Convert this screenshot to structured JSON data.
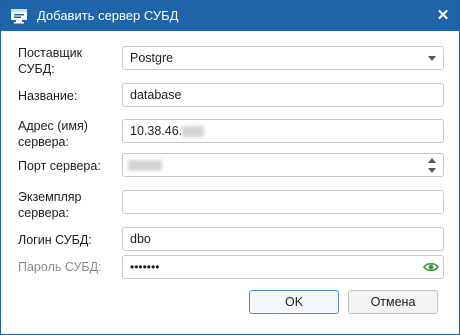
{
  "dialog": {
    "title": "Добавить сервер СУБД",
    "close_glyph": "✕",
    "title_icon": "server-window-icon"
  },
  "fields": {
    "provider": {
      "label": "Поставщик СУБД:",
      "value": "Postgre"
    },
    "name": {
      "label": "Название:",
      "value": "database"
    },
    "address": {
      "label": "Адрес (имя) сервера:",
      "value": "10.38.46."
    },
    "port": {
      "label": "Порт сервера:",
      "value": ""
    },
    "instance": {
      "label": "Экземпляр сервера:",
      "value": ""
    },
    "login": {
      "label": "Логин СУБД:",
      "value": "dbo"
    },
    "password": {
      "label": "Пароль СУБД:",
      "value": "•••••••",
      "toggle_icon": "eye-icon"
    }
  },
  "buttons": {
    "ok": "OK",
    "cancel": "Отмена"
  },
  "colors": {
    "titlebar": "#1f64a8",
    "eye_icon": "#3a9a3a",
    "primary_border": "#4a8fd6"
  }
}
